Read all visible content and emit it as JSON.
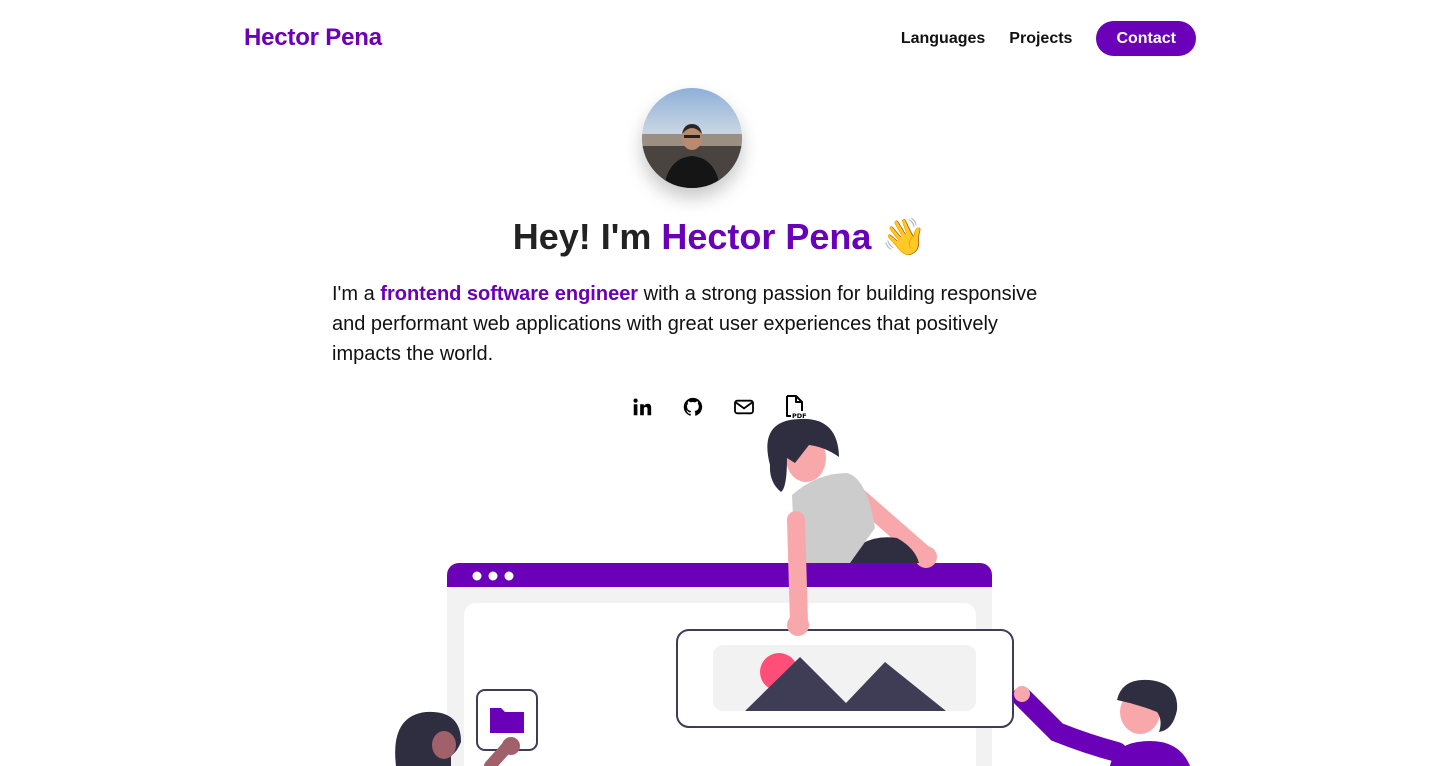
{
  "nav": {
    "brand": "Hector Pena",
    "links": [
      {
        "label": "Languages"
      },
      {
        "label": "Projects"
      }
    ],
    "contact_label": "Contact"
  },
  "hero": {
    "greeting_prefix": "Hey! I'm ",
    "name": "Hector Pena",
    "wave": "👋",
    "intro_prefix": "I'm a ",
    "intro_role": "frontend software engineer",
    "intro_suffix": " with a strong passion for building responsive and performant web applications with great user experiences that positively impacts the world."
  },
  "socials": [
    {
      "icon": "linkedin-icon"
    },
    {
      "icon": "github-icon"
    },
    {
      "icon": "mail-icon"
    },
    {
      "icon": "pdf-resume-icon",
      "badge": "PDF"
    }
  ],
  "colors": {
    "accent": "#6a00b8",
    "dark": "#3f3d56",
    "skin": "#f8a8ab",
    "pink_circle": "#ff4f79"
  }
}
